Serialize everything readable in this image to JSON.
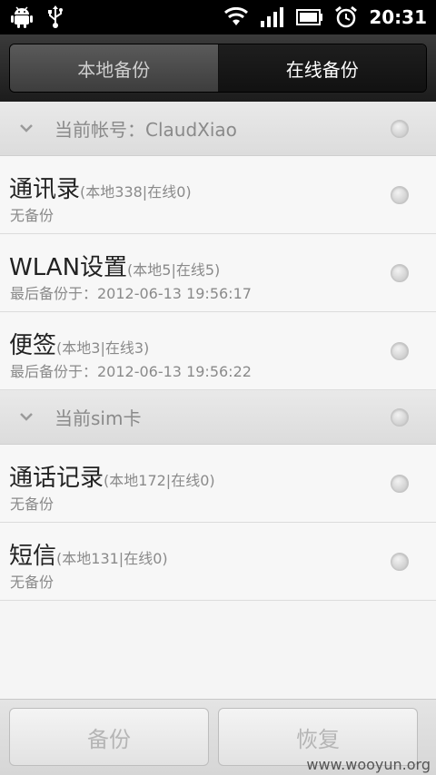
{
  "statusbar": {
    "time": "20:31",
    "icons": [
      "android-icon",
      "usb-icon",
      "wifi-icon",
      "signal-icon",
      "battery-icon",
      "alarm-icon"
    ]
  },
  "tabs": [
    {
      "label": "本地备份",
      "active": false
    },
    {
      "label": "在线备份",
      "active": true
    }
  ],
  "sections": [
    {
      "label": "当前帐号：ClaudXiao",
      "items": [
        {
          "title": "通讯录",
          "counts": "(本地338|在线0)",
          "status": "无备份"
        },
        {
          "title": "WLAN设置",
          "counts": "(本地5|在线5)",
          "status": "最后备份于：2012-06-13 19:56:17"
        },
        {
          "title": "便签",
          "counts": "(本地3|在线3)",
          "status": "最后备份于：2012-06-13 19:56:22"
        }
      ]
    },
    {
      "label": "当前sim卡",
      "items": [
        {
          "title": "通话记录",
          "counts": "(本地172|在线0)",
          "status": "无备份"
        },
        {
          "title": "短信",
          "counts": "(本地131|在线0)",
          "status": "无备份"
        }
      ]
    }
  ],
  "buttons": {
    "backup": "备份",
    "restore": "恢复"
  },
  "watermark": "www.wooyun.org"
}
